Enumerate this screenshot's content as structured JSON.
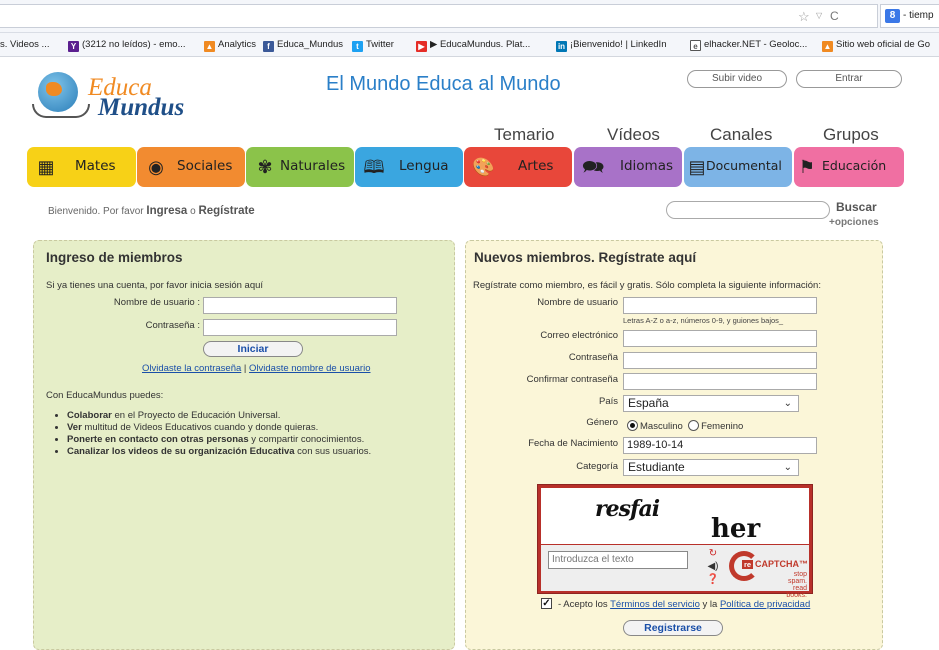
{
  "browser": {
    "search_engine_text": "tiemp",
    "bookmarks": [
      {
        "label": "s. Videos ...",
        "color": "#f5f5f5"
      },
      {
        "label": "(3212 no leídos) - emo...",
        "color": "#5b1f8f"
      },
      {
        "label": "Analytics",
        "color": "#f08a22"
      },
      {
        "label": "Educa_Mundus",
        "color": "#3b5998"
      },
      {
        "label": "Twitter",
        "color": "#1da1f2"
      },
      {
        "label": "▶ EducaMundus. Plat...",
        "color": "#e52d27"
      },
      {
        "label": "¡Bienvenido! | LinkedIn",
        "color": "#0077b5"
      },
      {
        "label": "elhacker.NET - Geoloc...",
        "color": "#555555"
      },
      {
        "label": "Sitio web oficial de Go",
        "color": "#f08a22"
      }
    ]
  },
  "header": {
    "logo_line1": "Educa",
    "logo_line2": "Mundus",
    "title": "El Mundo Educa al Mundo",
    "upload_label": "Subir video",
    "login_label": "Entrar"
  },
  "topnav": [
    "Temario",
    "Vídeos",
    "Canales",
    "Grupos"
  ],
  "categories": [
    {
      "label": "Mates",
      "color": "#f7d117"
    },
    {
      "label": "Sociales",
      "color": "#f28b30"
    },
    {
      "label": "Naturales",
      "color": "#8bc34a"
    },
    {
      "label": "Lengua",
      "color": "#3aa6e0"
    },
    {
      "label": "Artes",
      "color": "#e8473a"
    },
    {
      "label": "Idiomas",
      "color": "#a872c8"
    },
    {
      "label": "Documental",
      "color": "#7db4e6"
    },
    {
      "label": "Educación",
      "color": "#f06fa2"
    }
  ],
  "welcome": {
    "prefix": "Bienvenido. Por favor",
    "login": "Ingresa",
    "or": "o",
    "register": "Regístrate"
  },
  "search": {
    "button": "Buscar",
    "more": "+opciones"
  },
  "login_panel": {
    "title": "Ingreso de miembros",
    "intro": "Si ya tienes una cuenta, por favor inicia sesión aquí",
    "username_label": "Nombre de usuario :",
    "password_label": "Contraseña :",
    "submit": "Iniciar",
    "forgot_password": "Olvidaste la contraseña",
    "separator": "|",
    "forgot_username": "Olvidaste nombre de usuario",
    "features_title": "Con EducaMundus puedes:",
    "features": [
      {
        "bold": "Colaborar",
        "rest": " en el Proyecto de Educación Universal."
      },
      {
        "bold": "Ver",
        "rest": " multitud de Videos Educativos cuando y donde quieras."
      },
      {
        "bold": "Ponerte en contacto con otras personas",
        "rest": " y compartir conocimientos."
      },
      {
        "bold": "Canalizar los videos de su organización Educativa",
        "rest": " con sus usuarios."
      }
    ]
  },
  "register_panel": {
    "title": "Nuevos miembros. Regístrate aquí",
    "intro": "Regístrate como miembro, es fácil y gratis. Sólo completa la siguiente información:",
    "username_label": "Nombre de usuario",
    "username_hint": "Letras A-Z o a-z, números 0-9, y guiones bajos_",
    "email_label": "Correo electrónico",
    "password_label": "Contraseña",
    "confirm_label": "Confirmar contraseña",
    "country_label": "País",
    "country_value": "España",
    "gender_label": "Género",
    "gender_male": "Masculino",
    "gender_female": "Femenino",
    "birth_label": "Fecha de Nacimiento",
    "birth_value": "1989-10-14",
    "category_label": "Categoría",
    "category_value": "Estudiante",
    "captcha_word1": "resfai",
    "captcha_word2": "her",
    "captcha_placeholder": "Introduzca el texto",
    "captcha_brand_re": "re",
    "captcha_brand": "CAPTCHA™",
    "captcha_slogan1": "stop spam.",
    "captcha_slogan2": "read books.",
    "accept_prefix": "- Acepto los",
    "terms": "Términos del servicio",
    "and": "y la",
    "privacy": "Política de privacidad",
    "submit": "Registrarse"
  }
}
